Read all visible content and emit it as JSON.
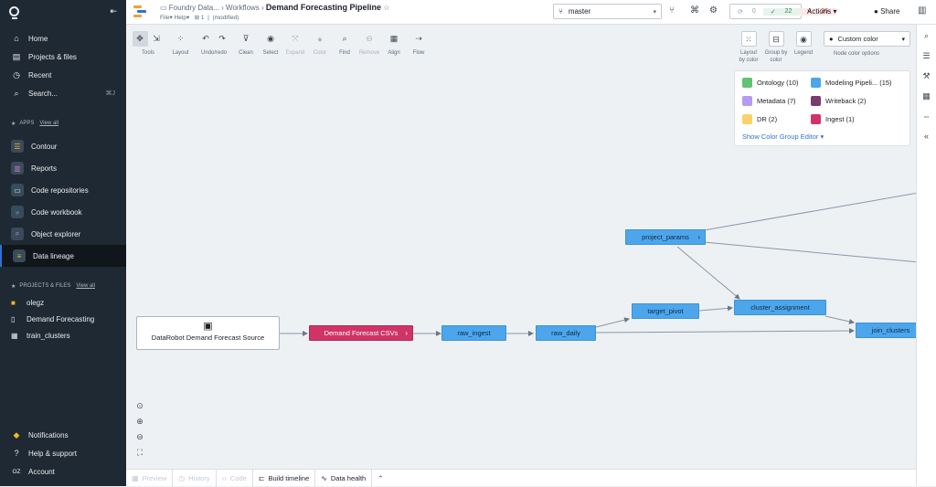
{
  "sidebar": {
    "nav": [
      {
        "label": "Home",
        "icon": "home-icon"
      },
      {
        "label": "Projects & files",
        "icon": "folder-icon"
      },
      {
        "label": "Recent",
        "icon": "clock-icon"
      },
      {
        "label": "Search...",
        "icon": "search-icon",
        "shortcut": "⌘J"
      }
    ],
    "apps_header": "APPS",
    "apps_view_all": "View all",
    "apps": [
      {
        "label": "Contour",
        "icon": "contour-icon"
      },
      {
        "label": "Reports",
        "icon": "reports-icon"
      },
      {
        "label": "Code repositories",
        "icon": "code-repository-icon"
      },
      {
        "label": "Code workbook",
        "icon": "code-workbook-icon"
      },
      {
        "label": "Object explorer",
        "icon": "object-explorer-icon"
      },
      {
        "label": "Data lineage",
        "icon": "data-lineage-icon"
      }
    ],
    "files_header": "PROJECTS & FILES",
    "files_view_all": "View all",
    "files": [
      {
        "label": "olegz",
        "icon": "folder-icon"
      },
      {
        "label": "Demand Forecasting",
        "icon": "document-icon"
      },
      {
        "label": "train_clusters",
        "icon": "dataset-icon"
      }
    ],
    "bottom": [
      {
        "label": "Notifications",
        "icon": "bell-icon"
      },
      {
        "label": "Help & support",
        "icon": "help-icon"
      },
      {
        "label": "Account",
        "icon": "account-icon",
        "initials": "OZ"
      }
    ]
  },
  "header": {
    "crumb1": "Foundry Data...",
    "crumb2": "Workflows",
    "title": "Demand Forecasting Pipeline",
    "menu_file": "File",
    "menu_help": "Help",
    "tabs_count": "1",
    "modified": "(modified)",
    "branch": "master",
    "status_grey": "0",
    "status_green": "22",
    "status_red": "26",
    "actions": "Actions",
    "share": "Share"
  },
  "toolbar": {
    "tools": "Tools",
    "layout": "Layout",
    "undo_redo": "Undo/redo",
    "clean": "Clean",
    "select": "Select",
    "expand": "Expand",
    "color": "Color",
    "find": "Find",
    "remove": "Remove",
    "align": "Align",
    "flow": "Flow",
    "layout_by_color": "Layout by color",
    "group_by_color": "Group by color",
    "legend": "Legend",
    "node_color_value": "Custom color",
    "node_color_caption": "Node color options"
  },
  "legend": {
    "items": [
      {
        "label": "Ontology (10)",
        "color": "#62c370"
      },
      {
        "label": "Modeling Pipeli... (15)",
        "color": "#4da6ec"
      },
      {
        "label": "Metadata (7)",
        "color": "#b59cf0"
      },
      {
        "label": "Writeback (2)",
        "color": "#7a3d6b"
      },
      {
        "label": "DR (2)",
        "color": "#fcd26a"
      },
      {
        "label": "Ingest (1)",
        "color": "#d03466"
      }
    ],
    "link": "Show Color Group Editor"
  },
  "graph": {
    "source": "DataRobot Demand Forecast Source",
    "ingest": "Demand Forecast CSVs",
    "raw_ingest": "raw_ingest",
    "raw_daily": "raw_daily",
    "target_pivot": "target_pivot",
    "project_params": "project_params",
    "cluster_assignment": "cluster_assignment",
    "join_clusters": "join_clusters"
  },
  "bottom_tabs": {
    "preview": "Preview",
    "history": "History",
    "code": "Code",
    "build_timeline": "Build timeline",
    "data_health": "Data health"
  },
  "colors": {
    "accent": "#2d72d2",
    "sidebar": "#1f2933",
    "node_blue": "#4da6ec",
    "node_ingest": "#d03466"
  }
}
